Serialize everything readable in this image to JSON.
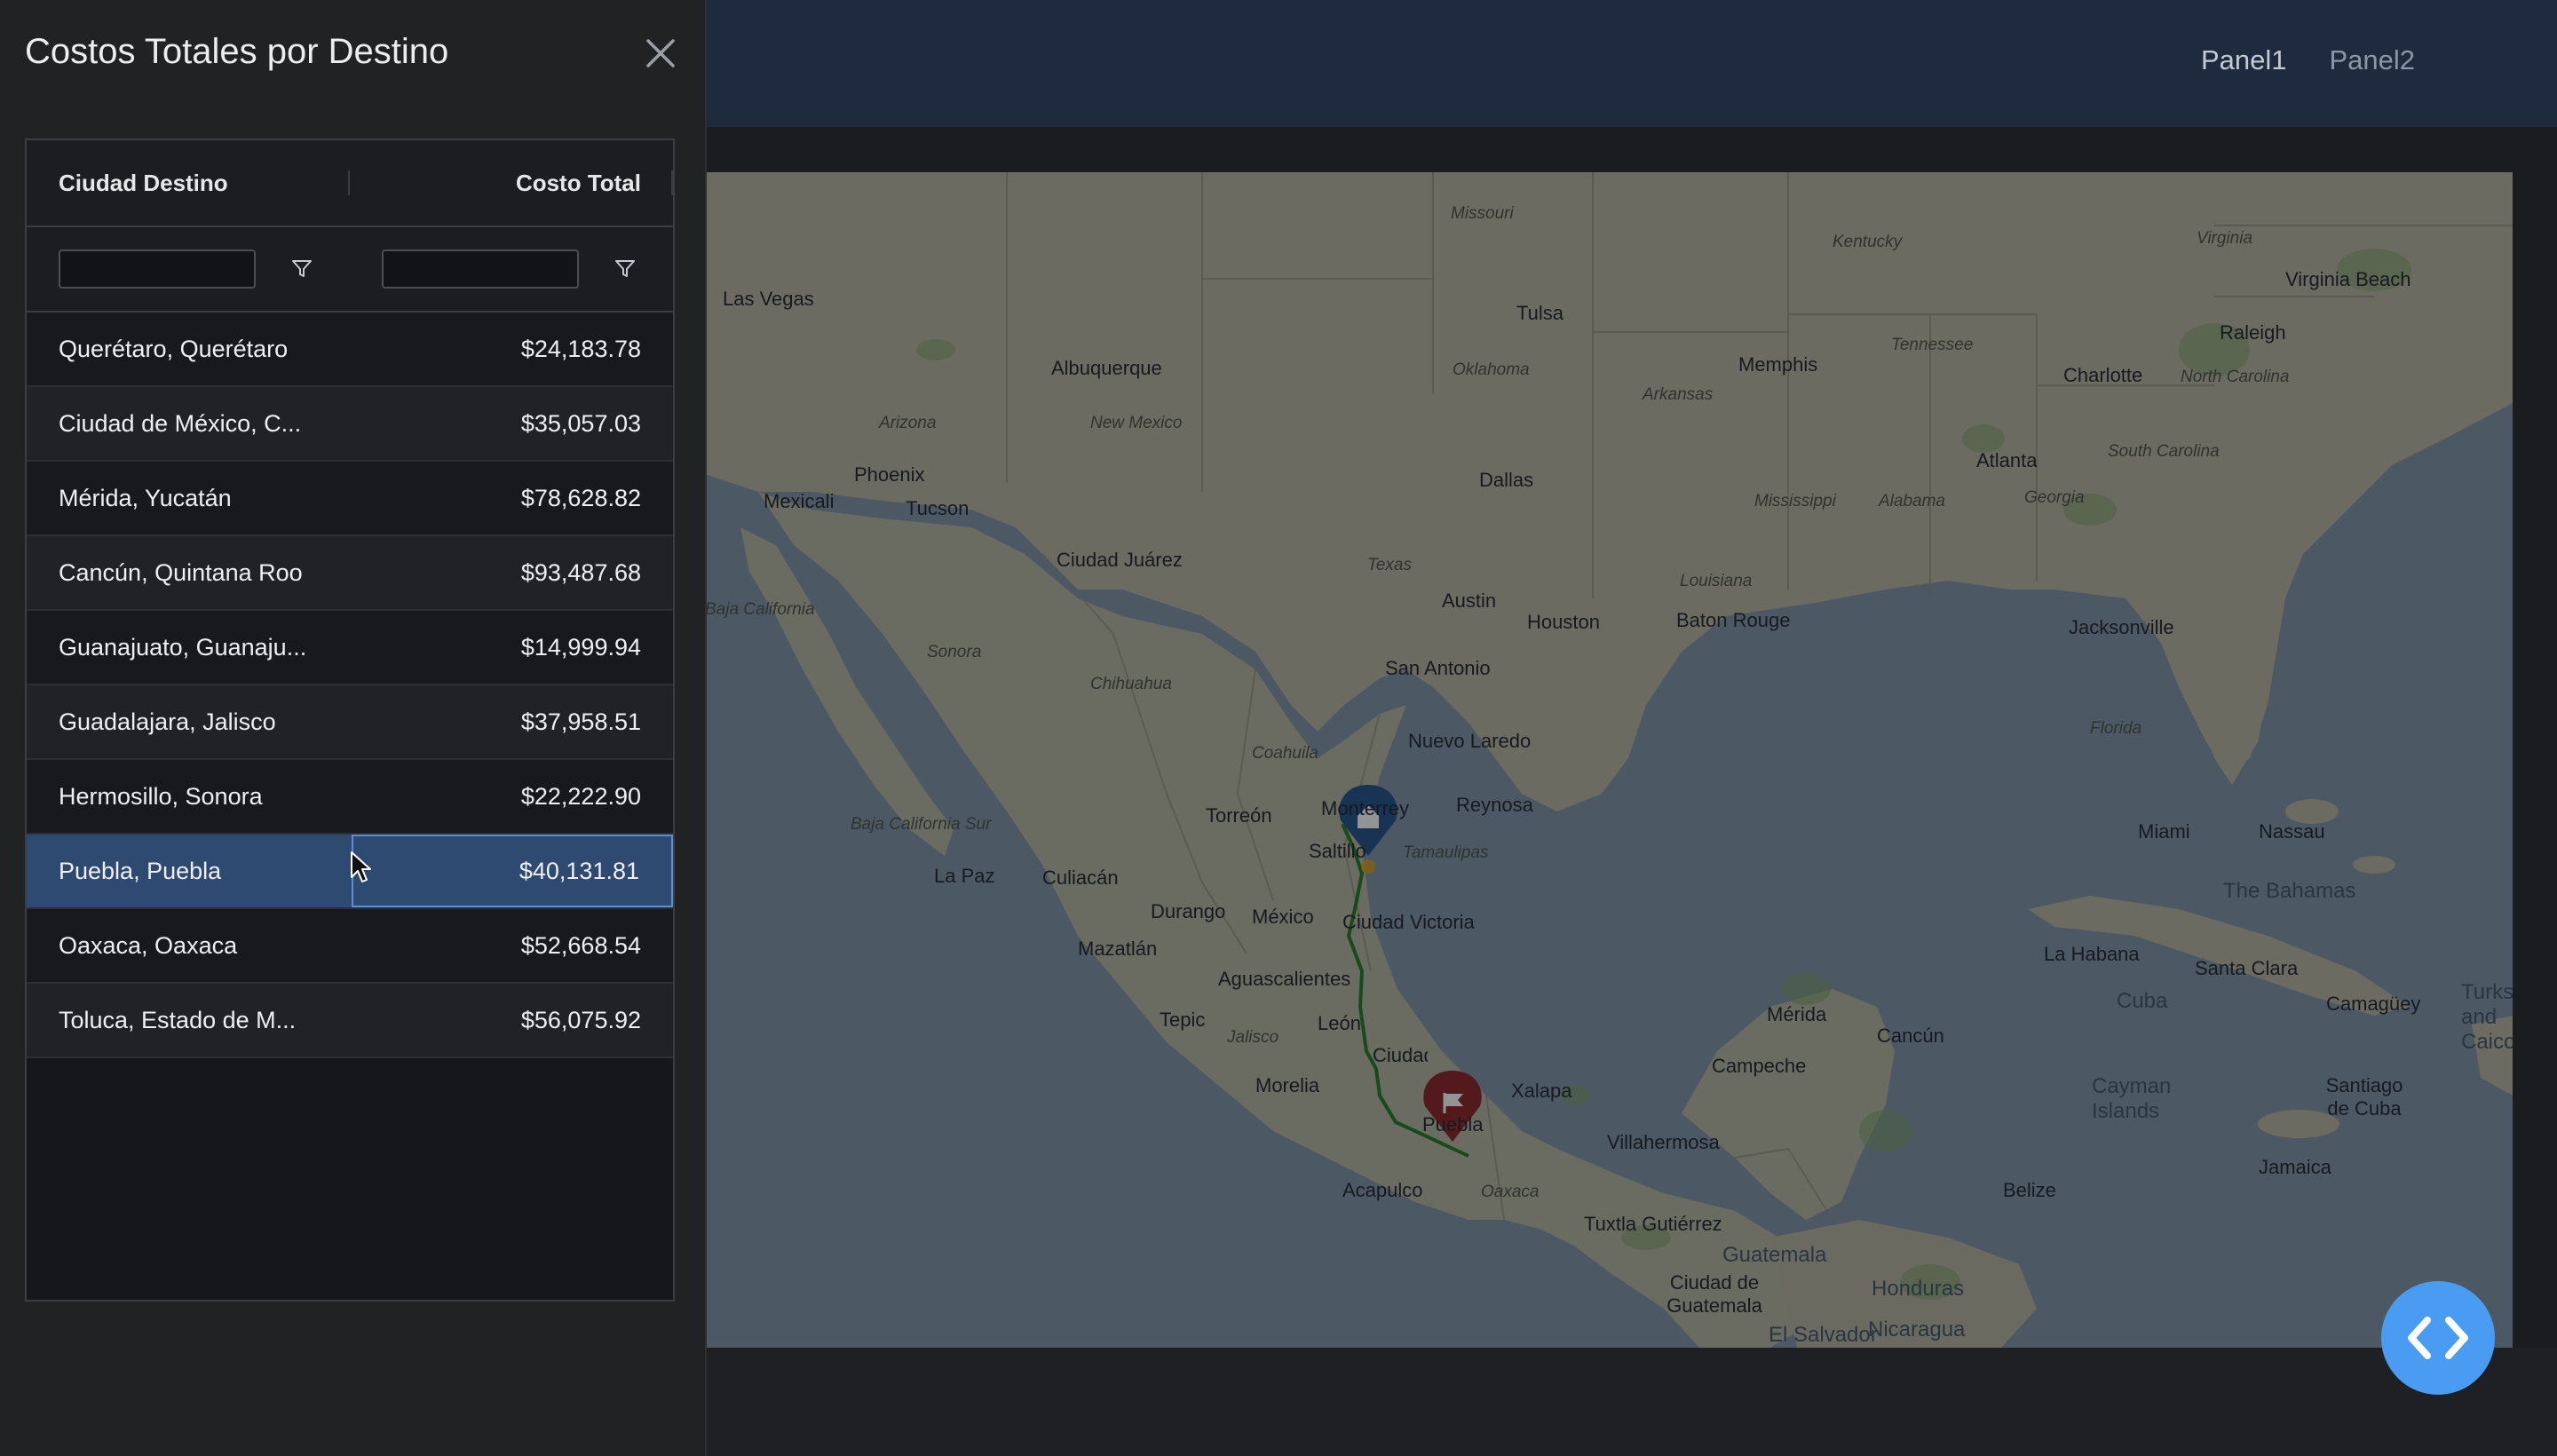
{
  "header": {
    "nav": [
      "Panel1",
      "Panel2"
    ],
    "active_nav": "Panel1"
  },
  "panel": {
    "title": "Costos Totales por Destino",
    "columns": {
      "city": "Ciudad Destino",
      "cost": "Costo Total"
    },
    "filters": {
      "city_value": "",
      "cost_value": ""
    },
    "rows": [
      {
        "city": "Querétaro, Querétaro",
        "cost": "$24,183.78"
      },
      {
        "city": "Ciudad de México, C...",
        "cost": "$35,057.03"
      },
      {
        "city": "Mérida, Yucatán",
        "cost": "$78,628.82"
      },
      {
        "city": "Cancún, Quintana Roo",
        "cost": "$93,487.68"
      },
      {
        "city": "Guanajuato, Guanaju...",
        "cost": "$14,999.94"
      },
      {
        "city": "Guadalajara, Jalisco",
        "cost": "$37,958.51"
      },
      {
        "city": "Hermosillo, Sonora",
        "cost": "$22,222.90"
      },
      {
        "city": "Puebla, Puebla",
        "cost": "$40,131.81"
      },
      {
        "city": "Oaxaca, Oaxaca",
        "cost": "$52,668.54"
      },
      {
        "city": "Toluca, Estado de M...",
        "cost": "$56,075.92"
      }
    ],
    "selected_row": "Puebla, Puebla"
  },
  "map": {
    "labels": [
      "Missouri",
      "Kentucky",
      "Virginia",
      "Virginia Beach",
      "Tulsa",
      "Memphis",
      "Tennessee",
      "Raleigh",
      "Las Vegas",
      "Albuquerque",
      "Oklahoma",
      "Charlotte",
      "North Carolina",
      "Arkansas",
      "Arizona",
      "New Mexico",
      "Dallas",
      "Atlanta",
      "South Carolina",
      "Phoenix",
      "Mississippi",
      "Alabama",
      "Georgia",
      "Mexicali",
      "Tucson",
      "Ciudad Juárez",
      "Texas",
      "Louisiana",
      "Austin",
      "Houston",
      "Baton Rouge",
      "Jacksonville",
      "Baja California",
      "Sonora",
      "San Antonio",
      "Chihuahua",
      "Florida",
      "Nuevo Laredo",
      "Coahuila",
      "Torreón",
      "Monterrey",
      "Reynosa",
      "Baja California Sur",
      "Saltillo",
      "Tamaulipas",
      "Miami",
      "Nassau",
      "La Paz",
      "Culiacán",
      "Durango",
      "México",
      "Ciudad Victoria",
      "The Bahamas",
      "Mazatlán",
      "La Habana",
      "Santa Clara",
      "Aguascalientes",
      "Cuba",
      "Camagüey",
      "Turks and Caicos",
      "Tepic",
      "Jalisco",
      "León",
      "Mérida",
      "Cancún",
      "Ciudad de México",
      "Xalapa",
      "Campeche",
      "Morelia",
      "Puebla",
      "Cayman Islands",
      "Santiago de Cuba",
      "Villahermosa",
      "Acapulco",
      "Oaxaca",
      "Jamaica",
      "Belize",
      "Tuxtla Gutiérrez",
      "Guatemala",
      "Ciudad de Guatemala",
      "Honduras",
      "El Salvador",
      "Nicaragua"
    ],
    "route": {
      "origin": "Monterrey",
      "destination": "Puebla",
      "line_color": "#1e7a1e"
    },
    "marker_colors": {
      "origin": "#1f4f86",
      "destination": "#8c1f24"
    }
  },
  "colors": {
    "accent": "#4a9cf2",
    "selected_row": "#2e4a70",
    "topbar": "#1e2a3d"
  }
}
